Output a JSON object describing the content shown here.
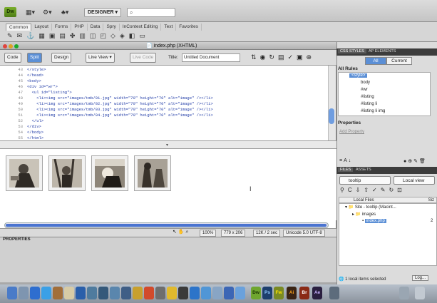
{
  "appbar": {
    "logo": "Dw",
    "workspace": "DESIGNER",
    "search_glyph": "⌕"
  },
  "insert": {
    "tabs": [
      "Common",
      "Layout",
      "Forms",
      "PHP",
      "Data",
      "Spry",
      "InContext Editing",
      "Text",
      "Favorites"
    ]
  },
  "doc": {
    "title": "index.php (XHTML)",
    "views": {
      "code": "Code",
      "split": "Split",
      "design": "Design",
      "live_view": "Live View",
      "live_code": "Live Code"
    },
    "title_label": "Title:",
    "title_value": "Untitled Document",
    "code_lines": [
      {
        "n": "43",
        "t": "</style>"
      },
      {
        "n": "44",
        "t": "</head>"
      },
      {
        "n": "45",
        "t": "<body>"
      },
      {
        "n": "46",
        "t": "<div id=\"wr\">"
      },
      {
        "n": "47",
        "t": "  <ul id=\"listing\">"
      },
      {
        "n": "48",
        "t": "    <li><img src=\"images/tmb/01.jpg\" width=\"70\" height=\"70\" alt=\"image\" /></li>"
      },
      {
        "n": "49",
        "t": "    <li><img src=\"images/tmb/02.jpg\" width=\"70\" height=\"70\" alt=\"image\" /></li>"
      },
      {
        "n": "50",
        "t": "    <li><img src=\"images/tmb/03.jpg\" width=\"70\" height=\"70\" alt=\"image\" /></li>"
      },
      {
        "n": "51",
        "t": "    <li><img src=\"images/tmb/04.jpg\" width=\"70\" height=\"70\" alt=\"image\" /></li>"
      },
      {
        "n": "52",
        "t": "  </ul>"
      },
      {
        "n": "53",
        "t": "</div>"
      },
      {
        "n": "54",
        "t": "</body>"
      },
      {
        "n": "55",
        "t": "</html>"
      }
    ]
  },
  "status": {
    "zoom": "100%",
    "size": "779 x 206",
    "download": "12K / 2 sec",
    "encoding": "Unicode 5.0 UTF-8"
  },
  "properties": {
    "label": "PROPERTIES"
  },
  "css_panel": {
    "tabs": [
      "CSS STYLES",
      "AP ELEMENTS"
    ],
    "all": "All",
    "current": "Current",
    "all_rules": "All Rules",
    "rules": [
      "<style>",
      "body",
      "#wr",
      "#listing",
      "#listing li",
      "#listing li img"
    ],
    "properties": "Properties",
    "add_property": "Add Property"
  },
  "files_panel": {
    "tabs": [
      "FILES",
      "ASSETS"
    ],
    "site": "tooltip",
    "view": "Local view",
    "local_files": "Local Files",
    "size_hdr": "Siz",
    "items": [
      {
        "label": "Site - tooltip (Macint..."
      },
      {
        "label": "images"
      },
      {
        "label": "index.php",
        "size": "2"
      }
    ],
    "status": "1 local items selected",
    "log": "Log..."
  },
  "dock": [
    "Dw",
    "Ps",
    "Fw",
    "Ai",
    "Br",
    "Ae"
  ]
}
